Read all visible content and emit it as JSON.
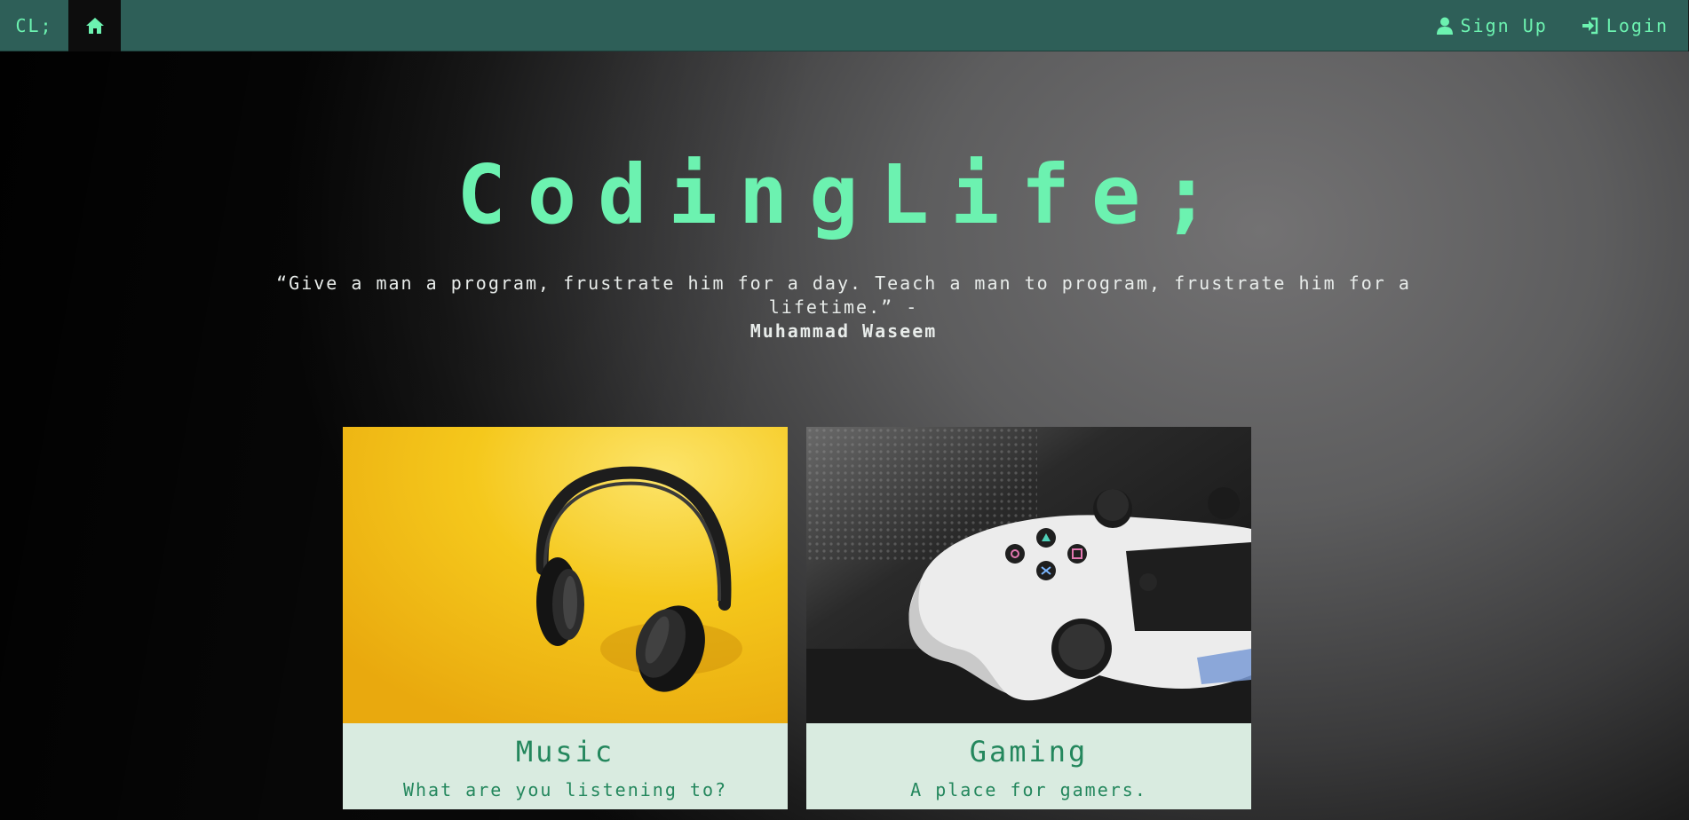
{
  "colors": {
    "accent": "#6cf2b0",
    "navbar_bg": "#2e5f58",
    "home_tab_bg": "#0d0d0d",
    "card_bg": "#d9ebe0",
    "card_text": "#24875d",
    "quote_text": "#e8ecea"
  },
  "navbar": {
    "brand": "CL;",
    "home_icon": "home-icon",
    "links": [
      {
        "label": "Sign Up",
        "icon": "user-icon"
      },
      {
        "label": "Login",
        "icon": "sign-in-icon"
      }
    ]
  },
  "hero": {
    "title": "CodingLife;",
    "quote": "“Give a man a program, frustrate him for a day. Teach a man to program, frustrate him for a lifetime.” -",
    "author": "Muhammad Waseem"
  },
  "cards": [
    {
      "title": "Music",
      "subtitle": "What are you listening to?",
      "image": "headphones-image"
    },
    {
      "title": "Gaming",
      "subtitle": "A place for gamers.",
      "image": "game-controller-image"
    }
  ]
}
